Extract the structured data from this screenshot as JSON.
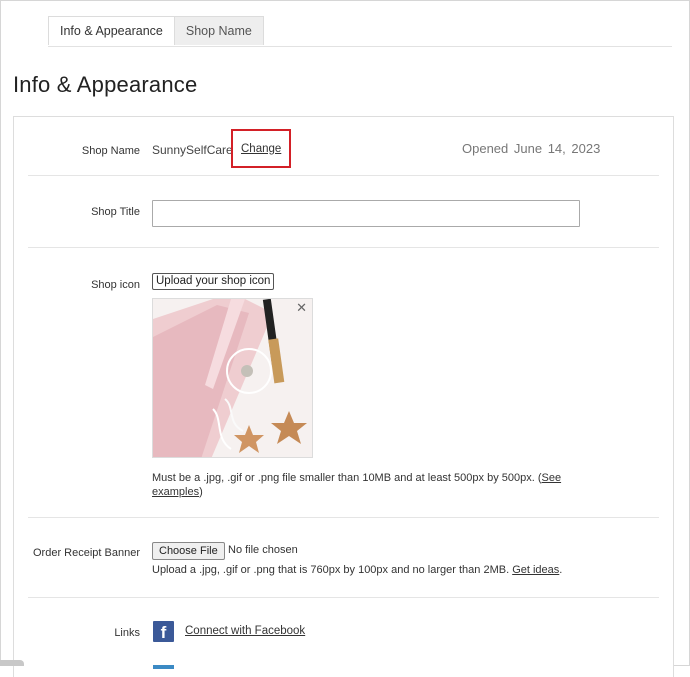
{
  "tabs": [
    {
      "label": "Info & Appearance",
      "active": true
    },
    {
      "label": "Shop Name",
      "active": false
    }
  ],
  "page_title": "Info & Appearance",
  "shop_name": {
    "label": "Shop Name",
    "value": "SunnySelfCare",
    "change_label": "Change",
    "opened_label": "Opened",
    "opened_date": "June 14, 2023"
  },
  "shop_title": {
    "label": "Shop Title",
    "value": "",
    "placeholder": ""
  },
  "shop_icon": {
    "label": "Shop icon",
    "upload_label": "Upload your shop icon",
    "remove_icon": "close-icon",
    "help_text": "Must be a .jpg, .gif or .png file smaller than 10MB and at least 500px by 500px. (",
    "help_link_1": "See",
    "help_link_2": "examples",
    "help_close": ")"
  },
  "order_receipt_banner": {
    "label": "Order Receipt Banner",
    "choose_file_label": "Choose File",
    "no_file_text": "No file chosen",
    "help_text": "Upload a .jpg, .gif or .png that is 760px by 100px and no larger than 2MB.",
    "help_link": "Get ideas",
    "help_end": "."
  },
  "links": {
    "label": "Links",
    "facebook_icon": "facebook-icon",
    "facebook_link": "Connect with Facebook"
  },
  "colors": {
    "highlight_box": "#d32027",
    "facebook_blue": "#3b5998"
  }
}
